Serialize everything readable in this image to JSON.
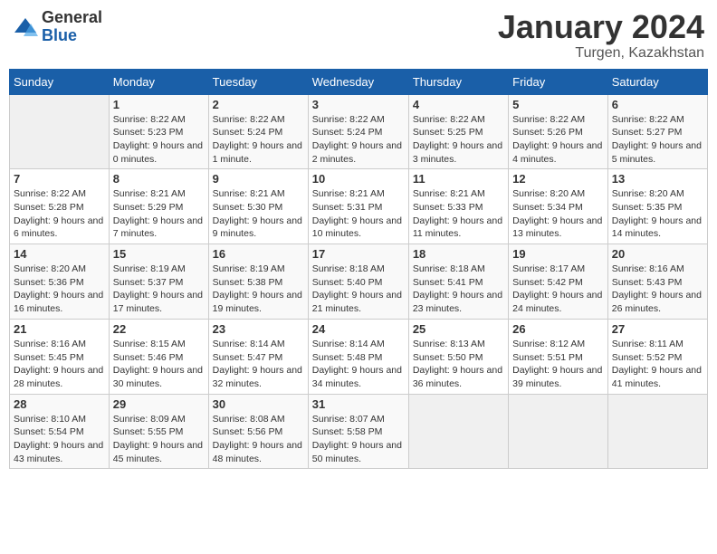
{
  "header": {
    "logo_general": "General",
    "logo_blue": "Blue",
    "title": "January 2024",
    "subtitle": "Turgen, Kazakhstan"
  },
  "days_of_week": [
    "Sunday",
    "Monday",
    "Tuesday",
    "Wednesday",
    "Thursday",
    "Friday",
    "Saturday"
  ],
  "weeks": [
    [
      {
        "num": "",
        "sunrise": "",
        "sunset": "",
        "daylight": ""
      },
      {
        "num": "1",
        "sunrise": "Sunrise: 8:22 AM",
        "sunset": "Sunset: 5:23 PM",
        "daylight": "Daylight: 9 hours and 0 minutes."
      },
      {
        "num": "2",
        "sunrise": "Sunrise: 8:22 AM",
        "sunset": "Sunset: 5:24 PM",
        "daylight": "Daylight: 9 hours and 1 minute."
      },
      {
        "num": "3",
        "sunrise": "Sunrise: 8:22 AM",
        "sunset": "Sunset: 5:24 PM",
        "daylight": "Daylight: 9 hours and 2 minutes."
      },
      {
        "num": "4",
        "sunrise": "Sunrise: 8:22 AM",
        "sunset": "Sunset: 5:25 PM",
        "daylight": "Daylight: 9 hours and 3 minutes."
      },
      {
        "num": "5",
        "sunrise": "Sunrise: 8:22 AM",
        "sunset": "Sunset: 5:26 PM",
        "daylight": "Daylight: 9 hours and 4 minutes."
      },
      {
        "num": "6",
        "sunrise": "Sunrise: 8:22 AM",
        "sunset": "Sunset: 5:27 PM",
        "daylight": "Daylight: 9 hours and 5 minutes."
      }
    ],
    [
      {
        "num": "7",
        "sunrise": "Sunrise: 8:22 AM",
        "sunset": "Sunset: 5:28 PM",
        "daylight": "Daylight: 9 hours and 6 minutes."
      },
      {
        "num": "8",
        "sunrise": "Sunrise: 8:21 AM",
        "sunset": "Sunset: 5:29 PM",
        "daylight": "Daylight: 9 hours and 7 minutes."
      },
      {
        "num": "9",
        "sunrise": "Sunrise: 8:21 AM",
        "sunset": "Sunset: 5:30 PM",
        "daylight": "Daylight: 9 hours and 9 minutes."
      },
      {
        "num": "10",
        "sunrise": "Sunrise: 8:21 AM",
        "sunset": "Sunset: 5:31 PM",
        "daylight": "Daylight: 9 hours and 10 minutes."
      },
      {
        "num": "11",
        "sunrise": "Sunrise: 8:21 AM",
        "sunset": "Sunset: 5:33 PM",
        "daylight": "Daylight: 9 hours and 11 minutes."
      },
      {
        "num": "12",
        "sunrise": "Sunrise: 8:20 AM",
        "sunset": "Sunset: 5:34 PM",
        "daylight": "Daylight: 9 hours and 13 minutes."
      },
      {
        "num": "13",
        "sunrise": "Sunrise: 8:20 AM",
        "sunset": "Sunset: 5:35 PM",
        "daylight": "Daylight: 9 hours and 14 minutes."
      }
    ],
    [
      {
        "num": "14",
        "sunrise": "Sunrise: 8:20 AM",
        "sunset": "Sunset: 5:36 PM",
        "daylight": "Daylight: 9 hours and 16 minutes."
      },
      {
        "num": "15",
        "sunrise": "Sunrise: 8:19 AM",
        "sunset": "Sunset: 5:37 PM",
        "daylight": "Daylight: 9 hours and 17 minutes."
      },
      {
        "num": "16",
        "sunrise": "Sunrise: 8:19 AM",
        "sunset": "Sunset: 5:38 PM",
        "daylight": "Daylight: 9 hours and 19 minutes."
      },
      {
        "num": "17",
        "sunrise": "Sunrise: 8:18 AM",
        "sunset": "Sunset: 5:40 PM",
        "daylight": "Daylight: 9 hours and 21 minutes."
      },
      {
        "num": "18",
        "sunrise": "Sunrise: 8:18 AM",
        "sunset": "Sunset: 5:41 PM",
        "daylight": "Daylight: 9 hours and 23 minutes."
      },
      {
        "num": "19",
        "sunrise": "Sunrise: 8:17 AM",
        "sunset": "Sunset: 5:42 PM",
        "daylight": "Daylight: 9 hours and 24 minutes."
      },
      {
        "num": "20",
        "sunrise": "Sunrise: 8:16 AM",
        "sunset": "Sunset: 5:43 PM",
        "daylight": "Daylight: 9 hours and 26 minutes."
      }
    ],
    [
      {
        "num": "21",
        "sunrise": "Sunrise: 8:16 AM",
        "sunset": "Sunset: 5:45 PM",
        "daylight": "Daylight: 9 hours and 28 minutes."
      },
      {
        "num": "22",
        "sunrise": "Sunrise: 8:15 AM",
        "sunset": "Sunset: 5:46 PM",
        "daylight": "Daylight: 9 hours and 30 minutes."
      },
      {
        "num": "23",
        "sunrise": "Sunrise: 8:14 AM",
        "sunset": "Sunset: 5:47 PM",
        "daylight": "Daylight: 9 hours and 32 minutes."
      },
      {
        "num": "24",
        "sunrise": "Sunrise: 8:14 AM",
        "sunset": "Sunset: 5:48 PM",
        "daylight": "Daylight: 9 hours and 34 minutes."
      },
      {
        "num": "25",
        "sunrise": "Sunrise: 8:13 AM",
        "sunset": "Sunset: 5:50 PM",
        "daylight": "Daylight: 9 hours and 36 minutes."
      },
      {
        "num": "26",
        "sunrise": "Sunrise: 8:12 AM",
        "sunset": "Sunset: 5:51 PM",
        "daylight": "Daylight: 9 hours and 39 minutes."
      },
      {
        "num": "27",
        "sunrise": "Sunrise: 8:11 AM",
        "sunset": "Sunset: 5:52 PM",
        "daylight": "Daylight: 9 hours and 41 minutes."
      }
    ],
    [
      {
        "num": "28",
        "sunrise": "Sunrise: 8:10 AM",
        "sunset": "Sunset: 5:54 PM",
        "daylight": "Daylight: 9 hours and 43 minutes."
      },
      {
        "num": "29",
        "sunrise": "Sunrise: 8:09 AM",
        "sunset": "Sunset: 5:55 PM",
        "daylight": "Daylight: 9 hours and 45 minutes."
      },
      {
        "num": "30",
        "sunrise": "Sunrise: 8:08 AM",
        "sunset": "Sunset: 5:56 PM",
        "daylight": "Daylight: 9 hours and 48 minutes."
      },
      {
        "num": "31",
        "sunrise": "Sunrise: 8:07 AM",
        "sunset": "Sunset: 5:58 PM",
        "daylight": "Daylight: 9 hours and 50 minutes."
      },
      {
        "num": "",
        "sunrise": "",
        "sunset": "",
        "daylight": ""
      },
      {
        "num": "",
        "sunrise": "",
        "sunset": "",
        "daylight": ""
      },
      {
        "num": "",
        "sunrise": "",
        "sunset": "",
        "daylight": ""
      }
    ]
  ]
}
